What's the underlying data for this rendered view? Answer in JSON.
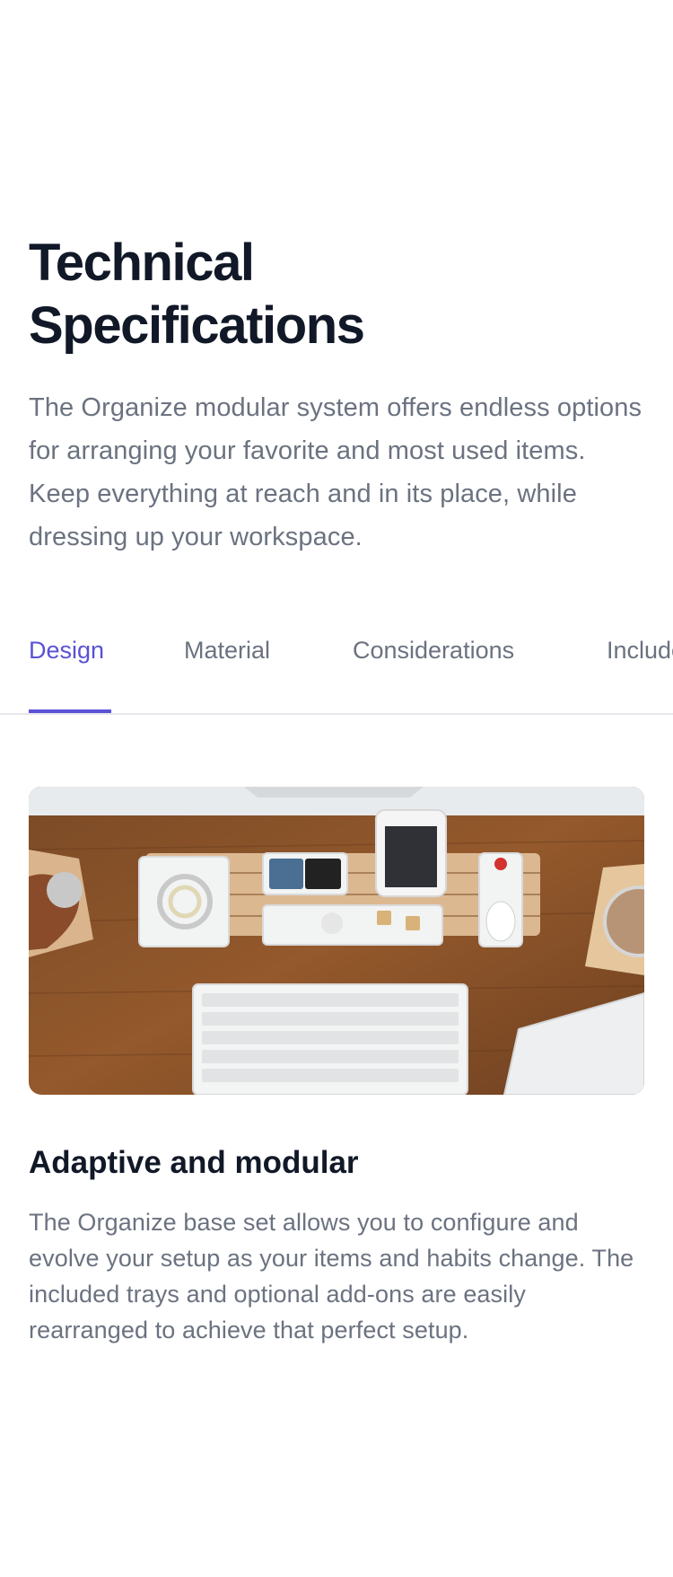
{
  "header": {
    "title_line1": "Technical",
    "title_line2": "Specifications",
    "description": "The Organize modular system offers endless options for arranging your favorite and most used items. Keep everything at reach and in its place, while dressing up your workspace."
  },
  "tabs": [
    {
      "label": "Design",
      "active": true
    },
    {
      "label": "Material",
      "active": false
    },
    {
      "label": "Considerations",
      "active": false
    },
    {
      "label": "Included",
      "active": false
    }
  ],
  "feature": {
    "image_icon": "desk-organizer-photo",
    "title": "Adaptive and modular",
    "body": "The Organize base set allows you to configure and evolve your setup as your items and habits change. The included trays and optional add-ons are easily rearranged to achieve that perfect setup."
  },
  "colors": {
    "accent": "#5a51d6",
    "heading": "#111827",
    "text_muted": "#6b7280",
    "divider": "#e5e7eb"
  }
}
